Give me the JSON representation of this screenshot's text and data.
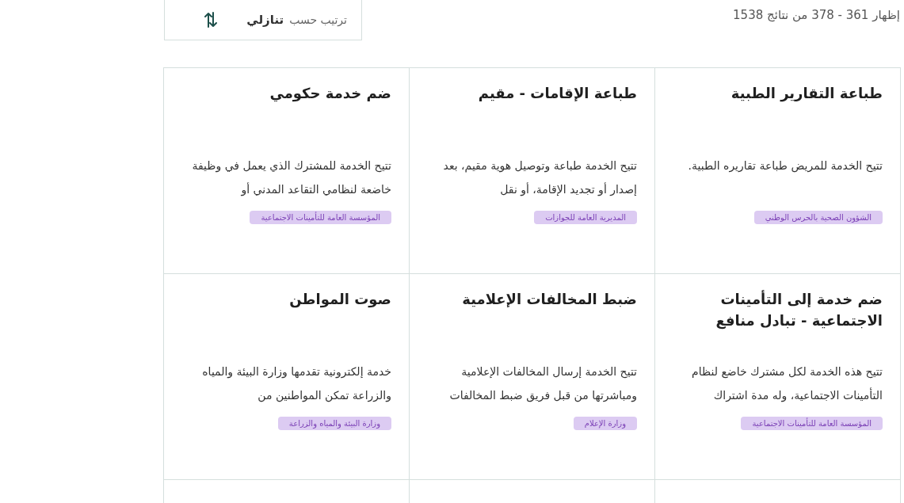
{
  "results_summary": "إظهار 361 - 378 من نتائج 1538",
  "sort": {
    "label": "ترتيب حسب",
    "value": "تنازلي"
  },
  "services": [
    {
      "title": "طباعة التقارير الطبية",
      "description": "تتيح الخدمة للمريض طباعة تقاريره الطبية.",
      "agency": "الشؤون الصحية بالحرس الوطني"
    },
    {
      "title": "طباعة الإقامات - مقيم",
      "description": "تتيح الخدمة طباعة وتوصيل هوية مقيم، بعد إصدار أو تجديد الإقامة، أو نقل",
      "agency": "المديرية العامة للجوازات"
    },
    {
      "title": "ضم خدمة حكومي",
      "description": "تتيح الخدمة للمشترك الذي يعمل في وظيفة خاضعة لنظامي التقاعد المدني أو",
      "agency": "المؤسسة العامة للتأمينات الاجتماعية"
    },
    {
      "title": "ضم خدمة إلى التأمينات الاجتماعية - تبادل منافع",
      "description": "تتيح هذه الخدمة لكل مشترك خاضع لنظام التأمينات الاجتماعية، وله مدة اشتراك",
      "agency": "المؤسسة العامة للتأمينات الاجتماعية"
    },
    {
      "title": "ضبط المخالفات الإعلامية",
      "description": "تتيح الخدمة إرسال المخالفات الإعلامية ومباشرتها من قبل فريق ضبط المخالفات",
      "agency": "وزارة الإعلام"
    },
    {
      "title": "صوت المواطن",
      "description": "خدمة إلكترونية تقدمها وزارة البيئة والمياه والزراعة تمكن المواطنين من",
      "agency": "وزارة البيئة والمياه والزراعة"
    }
  ]
}
